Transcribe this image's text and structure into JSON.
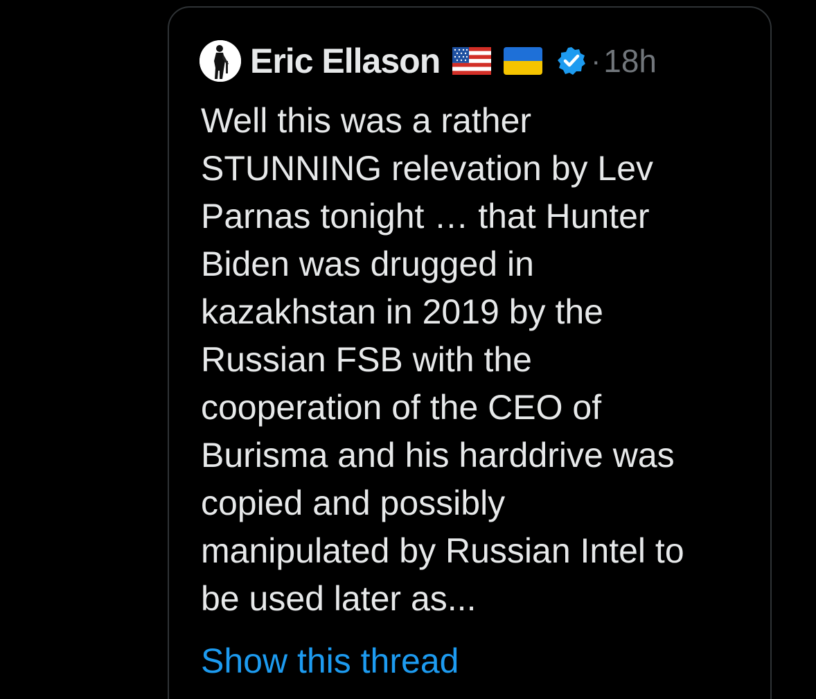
{
  "tweet": {
    "author": {
      "name": "Eric Ellason",
      "avatar_icon": "soldier-silhouette-avatar",
      "flags": [
        "us-flag-icon",
        "ukraine-flag-icon"
      ],
      "verified_icon": "verified-badge-icon"
    },
    "separator": "·",
    "time": "18h",
    "text": "Well this was a rather\nSTUNNING relevation by Lev\nParnas tonight … that Hunter\nBiden was drugged in\nkazakhstan in 2019 by the\nRussian FSB with the\ncooperation of the CEO of\nBurisma and his harddrive was\ncopied and possibly\nmanipulated by Russian Intel to\nbe used later as...",
    "show_thread_label": "Show this thread"
  },
  "colors": {
    "background": "#000000",
    "text_primary": "#e7e9ea",
    "text_secondary": "#71767b",
    "link": "#1d9bf0",
    "border": "#2f3336",
    "verified": "#1d9bf0"
  }
}
